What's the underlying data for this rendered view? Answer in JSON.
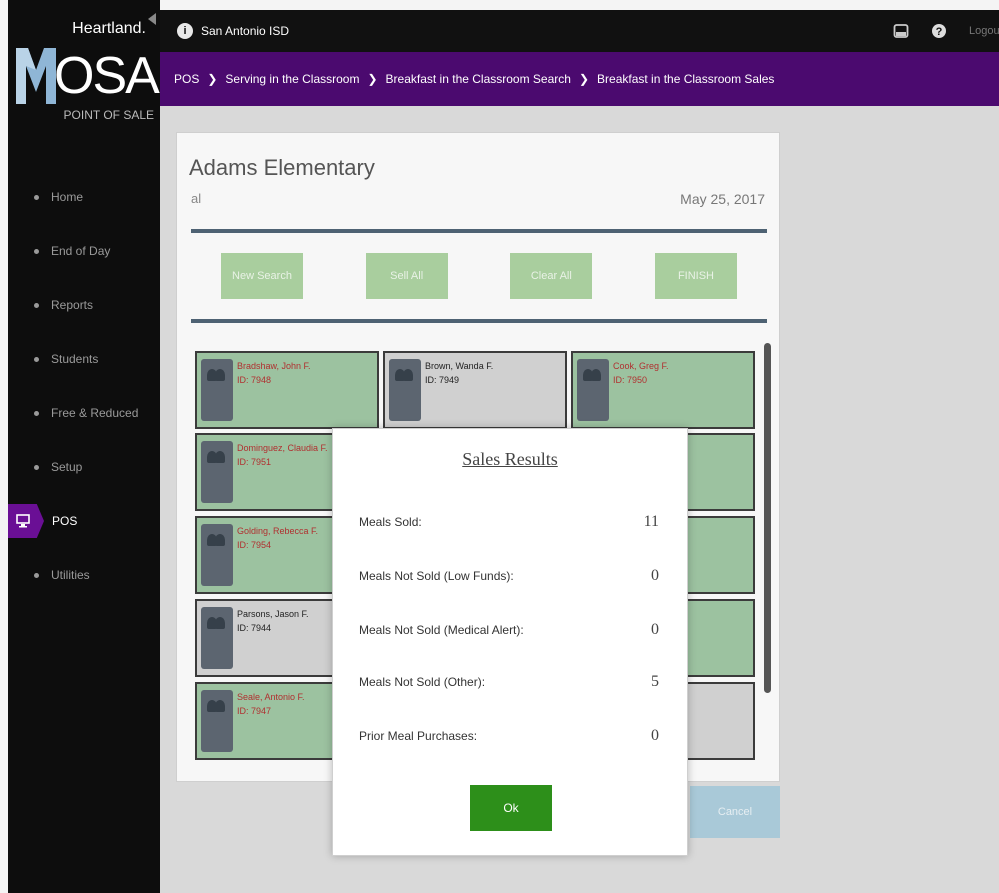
{
  "topbar": {
    "district": "San Antonio ISD",
    "logout_label": "Logout"
  },
  "logo": {
    "brand": "Heartland.",
    "name_rest": "OSAIC",
    "tagline": "POINT OF SALE"
  },
  "nav": {
    "items": [
      {
        "label": "Home"
      },
      {
        "label": "End of Day"
      },
      {
        "label": "Reports"
      },
      {
        "label": "Students"
      },
      {
        "label": "Free & Reduced"
      },
      {
        "label": "Setup"
      },
      {
        "label": "POS"
      },
      {
        "label": "Utilities"
      }
    ]
  },
  "breadcrumb": {
    "items": [
      "POS",
      "Serving in the Classroom",
      "Breakfast in the Classroom Search",
      "Breakfast in the Classroom Sales"
    ]
  },
  "card": {
    "school": "Adams Elementary",
    "search_term": "al",
    "date": "May 25, 2017",
    "buttons": {
      "new_search": "New Search",
      "sell_all": "Sell All",
      "clear_all": "Clear All",
      "finish": "FINISH"
    },
    "cancel_label": "Cancel"
  },
  "students": [
    {
      "name": "Bradshaw, John F.",
      "id": "ID: 7948"
    },
    {
      "name": "Brown, Wanda F.",
      "id": "ID: 7949"
    },
    {
      "name": "Cook, Greg F.",
      "id": "ID: 7950"
    },
    {
      "name": "Dominguez, Claudia F.",
      "id": "ID: 7951"
    },
    {
      "name": "Golding, Rebecca F.",
      "id": "ID: 7954"
    },
    {
      "name": "Parsons, Jason F.",
      "id": "ID: 7944"
    },
    {
      "name": "Seale, Antonio F.",
      "id": "ID: 7947"
    }
  ],
  "modal": {
    "title": "Sales Results",
    "rows": [
      {
        "label": "Meals Sold:",
        "value": "11"
      },
      {
        "label": "Meals Not Sold (Low Funds):",
        "value": "0"
      },
      {
        "label": "Meals Not Sold (Medical Alert):",
        "value": "0"
      },
      {
        "label": "Meals Not Sold (Other):",
        "value": "5"
      },
      {
        "label": "Prior Meal Purchases:",
        "value": "0"
      }
    ],
    "ok_label": "Ok"
  }
}
